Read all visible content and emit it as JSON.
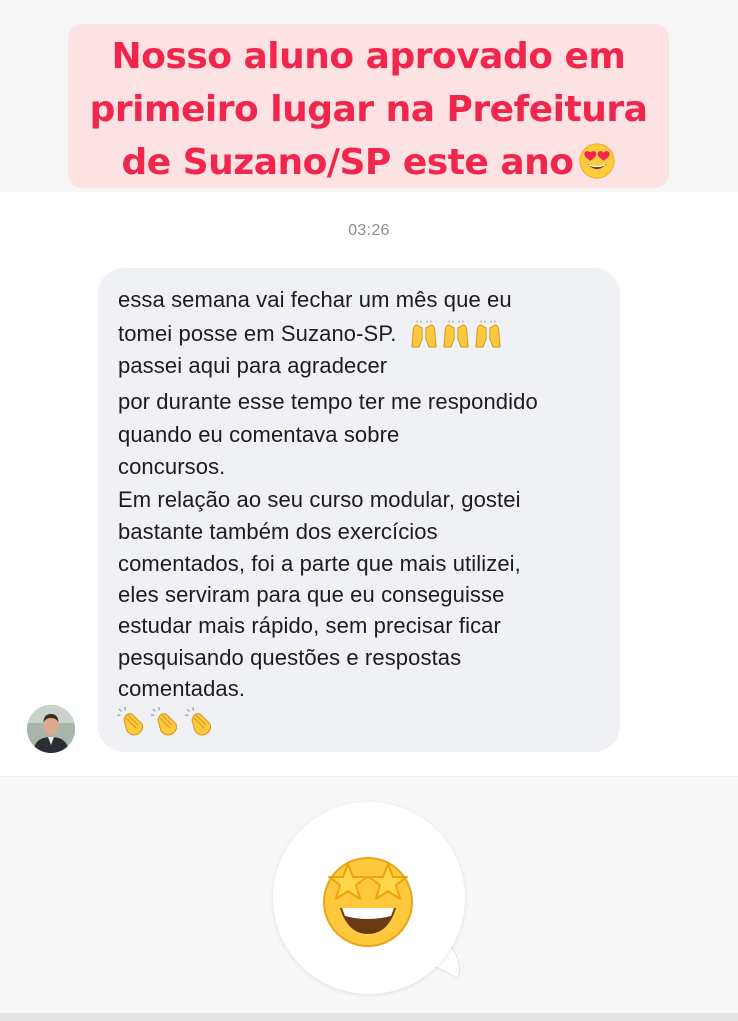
{
  "headline": {
    "lines": [
      "Nosso aluno aprovado em",
      "primeiro lugar na Prefeitura",
      "de Suzano/SP este ano"
    ],
    "emoji": "heart-eyes-emoji",
    "text_color": "#f0264c",
    "card_color": "#fde2e4"
  },
  "chat": {
    "timestamp": "03:26",
    "message": {
      "lines": [
        "essa semana vai fechar um mês que eu",
        "tomei posse em Suzano-SP.",
        "passei aqui para agradecer",
        "por durante esse tempo ter me respondido",
        "quando eu comentava sobre",
        "concursos.",
        "Em relação ao seu curso modular, gostei",
        "bastante também dos exercícios",
        "comentados, foi a parte que mais utilizei,",
        "eles serviram para que eu conseguisse",
        "estudar mais rápido, sem precisar ficar",
        "pesquisando questões e respostas",
        "comentadas."
      ],
      "inline_emojis": [
        "raising-hands-emoji",
        "raising-hands-emoji",
        "raising-hands-emoji"
      ],
      "trailing_emojis": [
        "clapping-hands-emoji",
        "clapping-hands-emoji",
        "clapping-hands-emoji"
      ],
      "bubble_color": "#eff1f5"
    },
    "sender": {
      "avatar": "avatar"
    },
    "reaction": {
      "emoji": "star-struck-emoji"
    }
  }
}
